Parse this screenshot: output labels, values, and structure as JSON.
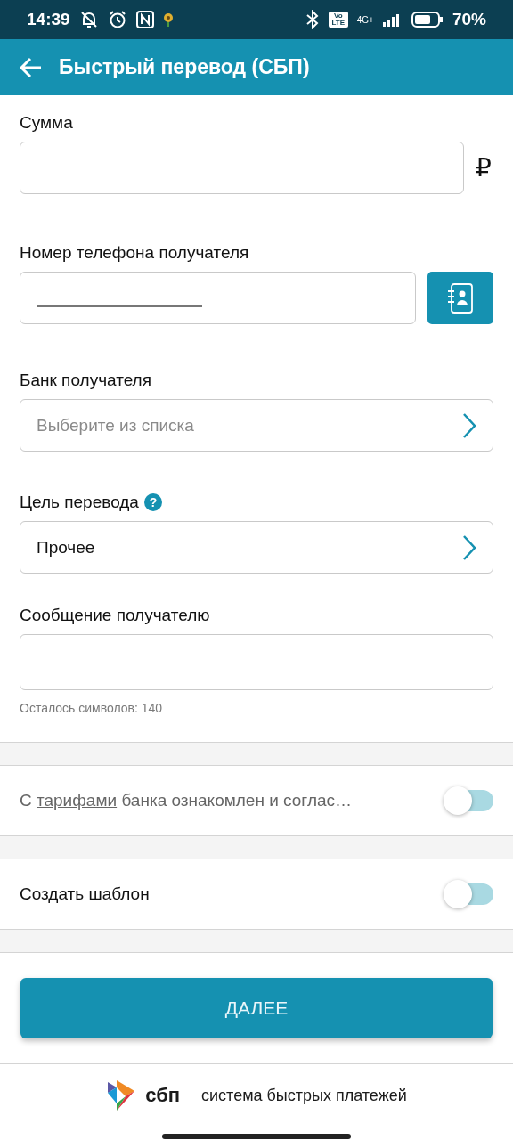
{
  "status_bar": {
    "time": "14:39",
    "volte": "Vo LTE",
    "network": "4G+",
    "battery": "70%"
  },
  "header": {
    "title": "Быстрый перевод (СБП)"
  },
  "amount": {
    "label": "Сумма",
    "currency": "₽"
  },
  "phone": {
    "label": "Номер телефона получателя"
  },
  "bank": {
    "label": "Банк получателя",
    "placeholder": "Выберите из списка"
  },
  "purpose": {
    "label": "Цель перевода",
    "help": "?",
    "value": "Прочее"
  },
  "message": {
    "label": "Сообщение получателю",
    "counter": "Осталось символов: 140"
  },
  "toggles": [
    {
      "kind": "terms",
      "prefix": "С ",
      "link": "тарифами",
      "suffix": " банка ознакомлен и соглас…",
      "on": false
    },
    {
      "kind": "plain",
      "label": "Создать шаблон",
      "on": false
    }
  ],
  "submit": {
    "label": "ДАЛЕЕ"
  },
  "footer": {
    "logo_text": "сбп",
    "tagline": "система быстрых платежей"
  }
}
